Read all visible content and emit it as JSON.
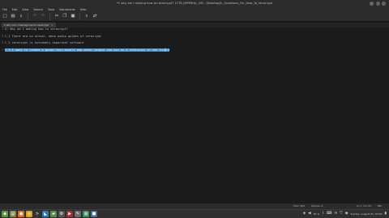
{
  "window": {
    "title": "*1 why am i making how to retarcrypt? 1778_IMPERIAL_OM - /Desktop/JL_Questions_For_How_To_Veracrypt",
    "controls": [
      "–",
      "□",
      "×"
    ]
  },
  "menubar": {
    "items": [
      "File",
      "Edit",
      "View",
      "Search",
      "Tools",
      "Documents",
      "Help"
    ]
  },
  "toolbar": {
    "icons": [
      "new-document-icon",
      "open-icon",
      "save-icon",
      "undo-icon",
      "redo-icon",
      "cut-icon",
      "copy-icon",
      "paste-icon",
      "search-icon",
      "replace-icon"
    ]
  },
  "tabs": [
    {
      "label": "1 why am i making how to veracrypt",
      "close": "×"
    }
  ],
  "editor": {
    "lines": [
      {
        "no": "1",
        "text": "Q: Why am I making how to veracrypt?",
        "selected": false
      },
      {
        "no": "2",
        "text": "",
        "selected": false
      },
      {
        "no": "3",
        "text": "C_1 There are no actual, deep audio guides of veracrypt",
        "selected": false
      },
      {
        "no": "4",
        "text": "",
        "selected": false
      },
      {
        "no": "5",
        "text": "C_2 veracrypt is extremely important software",
        "selected": false
      },
      {
        "no": "6",
        "text": "",
        "selected": false
      },
      {
        "no": "7",
        "text": "C_3 I want to create a guide that myself and other people can use as a reference in the future",
        "selected": true
      }
    ]
  },
  "statusbar": {
    "syntax": "Plain Text",
    "tab_width": "Spaces: 4",
    "position": "Ln 7, Col 94",
    "mode": "INS"
  },
  "taskbar": {
    "apps": [
      {
        "icon": "menu-icon",
        "color": "#4f9a3a"
      },
      {
        "icon": "files-icon",
        "color": "#7a8a4a"
      },
      {
        "icon": "firefox-icon",
        "color": "#e06a1a"
      },
      {
        "icon": "chrome-icon",
        "color": "#d9a21a"
      },
      {
        "icon": "terminal-icon",
        "color": "#333333"
      },
      {
        "icon": "vscode-icon",
        "color": "#2a7ac0"
      },
      {
        "icon": "folder-icon",
        "color": "#5a8a4a"
      },
      {
        "icon": "gear-icon",
        "color": "#555555"
      },
      {
        "icon": "media-icon",
        "color": "#a03030"
      },
      {
        "icon": "editor-icon",
        "color": "#6a6a6a"
      },
      {
        "icon": "image-icon",
        "color": "#3a8a5a"
      },
      {
        "icon": "app-icon",
        "color": "#4a6aa0"
      }
    ],
    "tray": {
      "battery": "90 %",
      "datetime": "Sunday, August 21, 04:20"
    }
  }
}
